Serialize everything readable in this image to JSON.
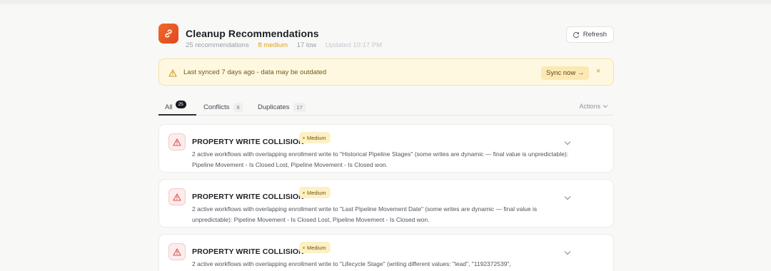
{
  "header": {
    "title": "Cleanup Recommendations",
    "meta": {
      "recommendations": "25 recommendations",
      "medium": "8 medium",
      "low": "17 low",
      "updated": "Updated 10:17 PM"
    },
    "refresh_label": "Refresh"
  },
  "banner": {
    "text": "Last synced 7 days ago - data may be outdated",
    "action_label": "Sync now →",
    "close_glyph": "×"
  },
  "tabs": [
    {
      "label": "All",
      "count": "25"
    },
    {
      "label": "Conflicts",
      "count": "8"
    },
    {
      "label": "Duplicates",
      "count": "17"
    }
  ],
  "actions_label": "Actions",
  "cards": [
    {
      "title": "PROPERTY WRITE COLLISION",
      "badge": "Medium",
      "description": "2 active workflows with overlapping enrollment write to \"Historical Pipeline Stages\" (some writes are dynamic — final value is unpredictable): Pipeline Movement - Is Closed Lost, Pipeline Movement - Is Closed won."
    },
    {
      "title": "PROPERTY WRITE COLLISION",
      "badge": "Medium",
      "description": "2 active workflows with overlapping enrollment write to \"Last Pipeline Movement Date\" (some writes are dynamic — final value is unpredictable): Pipeline Movement - Is Closed Lost, Pipeline Movement - Is Closed won."
    },
    {
      "title": "PROPERTY WRITE COLLISION",
      "badge": "Medium",
      "description": "2 active workflows with overlapping enrollment write to \"Lifecycle Stage\" (writing different values: \"lead\", \"1192372539\","
    }
  ],
  "colors": {
    "brand": "#e8541f",
    "warning_bg": "#fff8e1",
    "badge_bg": "#fdf0c4",
    "danger_icon": "#d9534f"
  },
  "icons": {
    "app": "link-icon",
    "refresh": "refresh-icon",
    "warning": "warning-triangle-icon",
    "close": "close-icon",
    "actions": "chevron-down-icon",
    "card": "alert-triangle-icon",
    "card_expand": "chevron-down-icon"
  }
}
